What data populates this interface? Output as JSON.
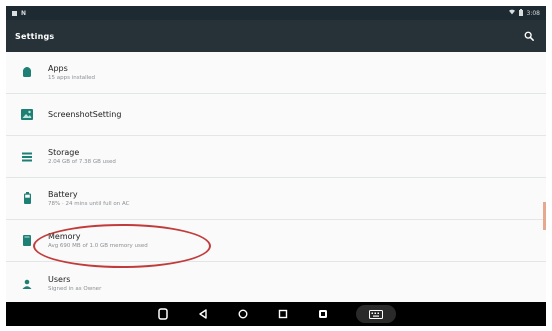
{
  "status_bar": {
    "time": "3:08"
  },
  "app_bar": {
    "title": "Settings",
    "search_icon": "search-icon"
  },
  "settings_items": [
    {
      "id": "apps",
      "icon": "android-icon",
      "title": "Apps",
      "subtitle": "15 apps installed"
    },
    {
      "id": "screenshot",
      "icon": "image-icon",
      "title": "ScreenshotSetting",
      "subtitle": ""
    },
    {
      "id": "storage",
      "icon": "storage-icon",
      "title": "Storage",
      "subtitle": "2.04 GB of 7.38 GB used"
    },
    {
      "id": "battery",
      "icon": "battery-icon",
      "title": "Battery",
      "subtitle": "78% · 24 mins until full on AC"
    },
    {
      "id": "memory",
      "icon": "memory-icon",
      "title": "Memory",
      "subtitle": "Avg 690 MB of 1.0 GB memory used"
    },
    {
      "id": "users",
      "icon": "user-icon",
      "title": "Users",
      "subtitle": "Signed in as Owner"
    }
  ],
  "colors": {
    "status_bar": "#1e2a31",
    "app_bar": "#263238",
    "icon_teal": "#1e7f74",
    "highlight_ring": "#c23b3b",
    "nav_bar": "#000000"
  },
  "nav_bar": [
    "rotate-icon",
    "back-icon",
    "home-icon",
    "recents-icon",
    "screenshot-icon",
    "keyboard-icon"
  ]
}
